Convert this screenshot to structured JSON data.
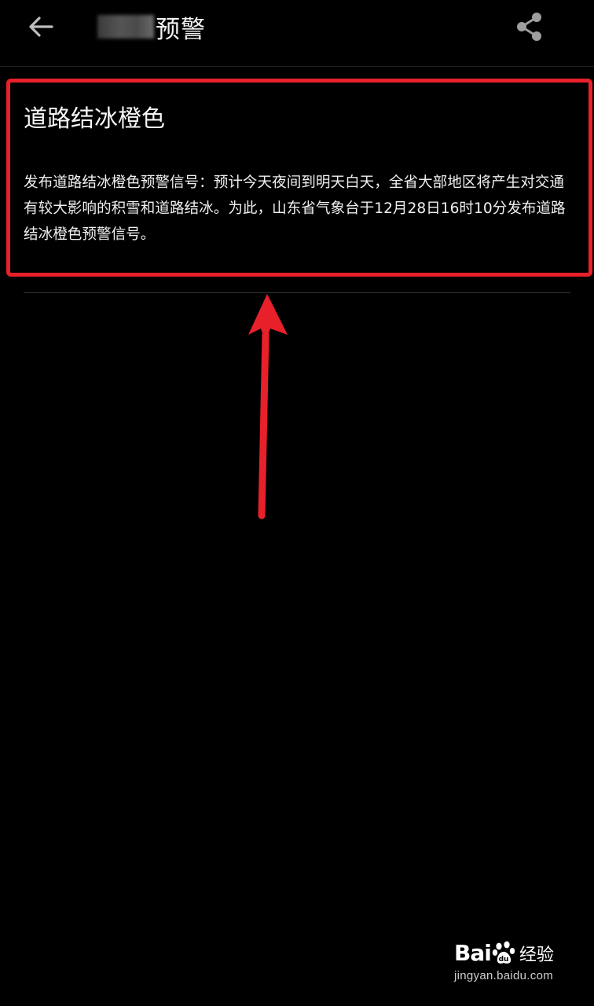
{
  "header": {
    "title_suffix": "预警",
    "back_icon": "arrow-left-icon",
    "share_icon": "share-icon"
  },
  "warning": {
    "title": "道路结冰橙色",
    "body": "发布道路结冰橙色预警信号：预计今天夜间到明天白天，全省大部地区将产生对交通有较大影响的积雪和道路结冰。为此，山东省气象台于12月28日16时10分发布道路结冰橙色预警信号。"
  },
  "annotation": {
    "highlight_color": "#e8202a"
  },
  "watermark": {
    "brand_left": "Bai",
    "brand_right": "经验",
    "url": "jingyan.baidu.com"
  }
}
